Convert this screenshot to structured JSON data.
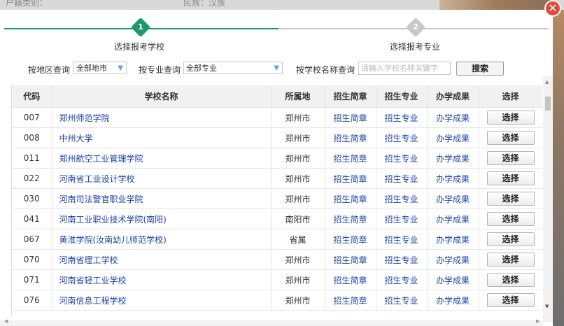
{
  "background": {
    "left_text": "户籍类别：",
    "mid_text": "民族：汉族"
  },
  "steps": [
    {
      "number": "1",
      "label": "选择报考学校"
    },
    {
      "number": "2",
      "label": "选择报考专业"
    }
  ],
  "filters": {
    "region_label": "按地区查询",
    "region_value": "全部地市",
    "major_label": "按专业查询",
    "major_value": "全部专业",
    "name_label": "按学校名称查询",
    "name_placeholder": "请输入学校名称关键字",
    "search_button": "搜索"
  },
  "table": {
    "headers": [
      "代码",
      "学校名称",
      "所属地",
      "招生简章",
      "招生专业",
      "办学成果",
      "选择"
    ],
    "rows": [
      {
        "code": "007",
        "name": "郑州师范学院",
        "location": "郑州市",
        "brochure": "招生简章",
        "majors": "招生专业",
        "results": "办学成果",
        "select": "选择"
      },
      {
        "code": "008",
        "name": "中州大学",
        "location": "郑州市",
        "brochure": "招生简章",
        "majors": "招生专业",
        "results": "办学成果",
        "select": "选择"
      },
      {
        "code": "011",
        "name": "郑州航空工业管理学院",
        "location": "郑州市",
        "brochure": "招生简章",
        "majors": "招生专业",
        "results": "办学成果",
        "select": "选择"
      },
      {
        "code": "022",
        "name": "河南省工业设计学校",
        "location": "郑州市",
        "brochure": "招生简章",
        "majors": "招生专业",
        "results": "办学成果",
        "select": "选择"
      },
      {
        "code": "030",
        "name": "河南司法警官职业学院",
        "location": "郑州市",
        "brochure": "招生简章",
        "majors": "招生专业",
        "results": "办学成果",
        "select": "选择"
      },
      {
        "code": "041",
        "name": "河南工业职业技术学院(南阳)",
        "location": "南阳市",
        "brochure": "招生简章",
        "majors": "招生专业",
        "results": "办学成果",
        "select": "选择"
      },
      {
        "code": "067",
        "name": "黄淮学院(汝南幼儿师范学校)",
        "location": "省属",
        "brochure": "招生简章",
        "majors": "招生专业",
        "results": "办学成果",
        "select": "选择"
      },
      {
        "code": "070",
        "name": "河南省理工学校",
        "location": "郑州市",
        "brochure": "招生简章",
        "majors": "招生专业",
        "results": "办学成果",
        "select": "选择"
      },
      {
        "code": "071",
        "name": "河南省轻工业学校",
        "location": "郑州市",
        "brochure": "招生简章",
        "majors": "招生专业",
        "results": "办学成果",
        "select": "选择"
      },
      {
        "code": "076",
        "name": "河南信息工程学校",
        "location": "郑州市",
        "brochure": "招生简章",
        "majors": "招生专业",
        "results": "办学成果",
        "select": "选择"
      }
    ]
  },
  "colors": {
    "accent": "#1a9a6a",
    "link": "#1a3fa8",
    "close": "#e24a3b"
  }
}
